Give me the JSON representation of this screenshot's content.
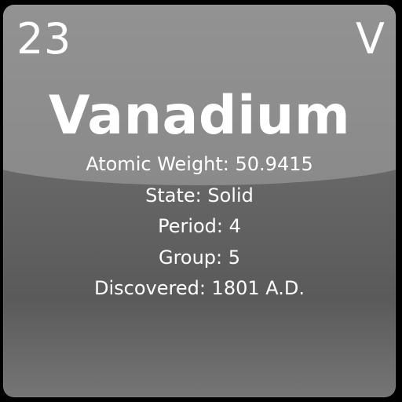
{
  "element": {
    "atomic_number": "23",
    "symbol": "V",
    "name": "Vanadium"
  },
  "details": [
    "Atomic Weight: 50.9415",
    "State: Solid",
    "Period: 4",
    "Group: 5",
    "Discovered: 1801 A.D."
  ],
  "colors": {
    "tile_gray": "#6e6e6e",
    "text": "#ffffff",
    "background": "#000000"
  }
}
